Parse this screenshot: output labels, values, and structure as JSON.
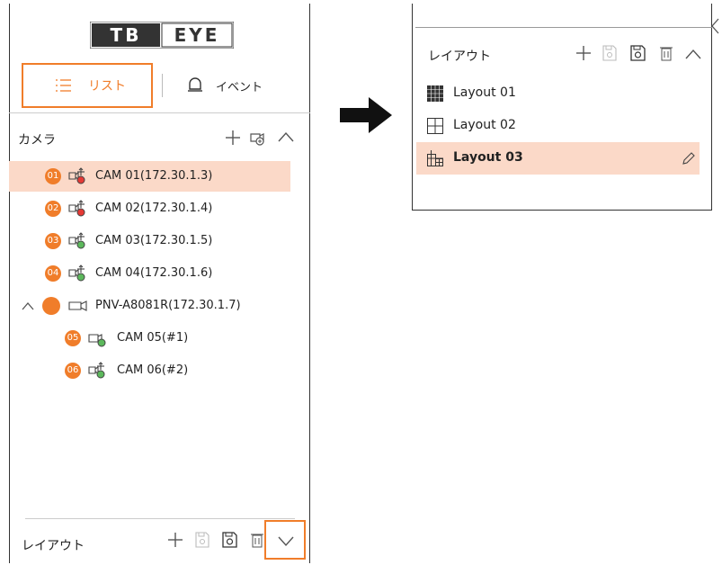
{
  "logo": {
    "part1": "TB",
    "part2": "EYE"
  },
  "tabs": [
    {
      "label": "リスト",
      "icon": "list-icon",
      "active": true
    },
    {
      "label": "イベント",
      "icon": "bell-icon",
      "active": false
    }
  ],
  "camera_section": {
    "title": "カメラ",
    "add_icon": "plus-icon",
    "add_group_icon": "camera-add-icon",
    "collapse_icon": "chevron-up-icon"
  },
  "cameras": [
    {
      "badge": "01",
      "label": "CAM 01(172.30.1.3)",
      "status": "red",
      "selected": true
    },
    {
      "badge": "02",
      "label": "CAM 02(172.30.1.4)",
      "status": "red",
      "selected": false
    },
    {
      "badge": "03",
      "label": "CAM 03(172.30.1.5)",
      "status": "green",
      "selected": false
    },
    {
      "badge": "04",
      "label": "CAM 04(172.30.1.6)",
      "status": "green",
      "selected": false
    }
  ],
  "device": {
    "label": "PNV-A8081R(172.30.1.7)",
    "expand_icon": "chevron-up-icon"
  },
  "device_channels": [
    {
      "badge": "05",
      "label": "CAM 05(#1)",
      "status": "green"
    },
    {
      "badge": "06",
      "label": "CAM 06(#2)",
      "status": "green"
    }
  ],
  "layout_section": {
    "title": "レイアウト",
    "icons": [
      "plus-icon",
      "save-icon",
      "save-as-icon",
      "trash-icon"
    ],
    "collapsed_toggle": "chevron-down-icon",
    "expanded_toggle": "chevron-up-icon"
  },
  "layouts": [
    {
      "label": "Layout 01",
      "icon": "grid-16-icon",
      "selected": false
    },
    {
      "label": "Layout 02",
      "icon": "grid-4-icon",
      "selected": false
    },
    {
      "label": "Layout 03",
      "icon": "grid-custom-icon",
      "selected": true,
      "edit_icon": "pencil-icon"
    }
  ],
  "arrow": "arrow-right-icon",
  "colors": {
    "accent": "#f07d2a",
    "selected_bg": "#fbd9c8",
    "status_red": "#e53935",
    "status_green": "#5cb85c"
  }
}
